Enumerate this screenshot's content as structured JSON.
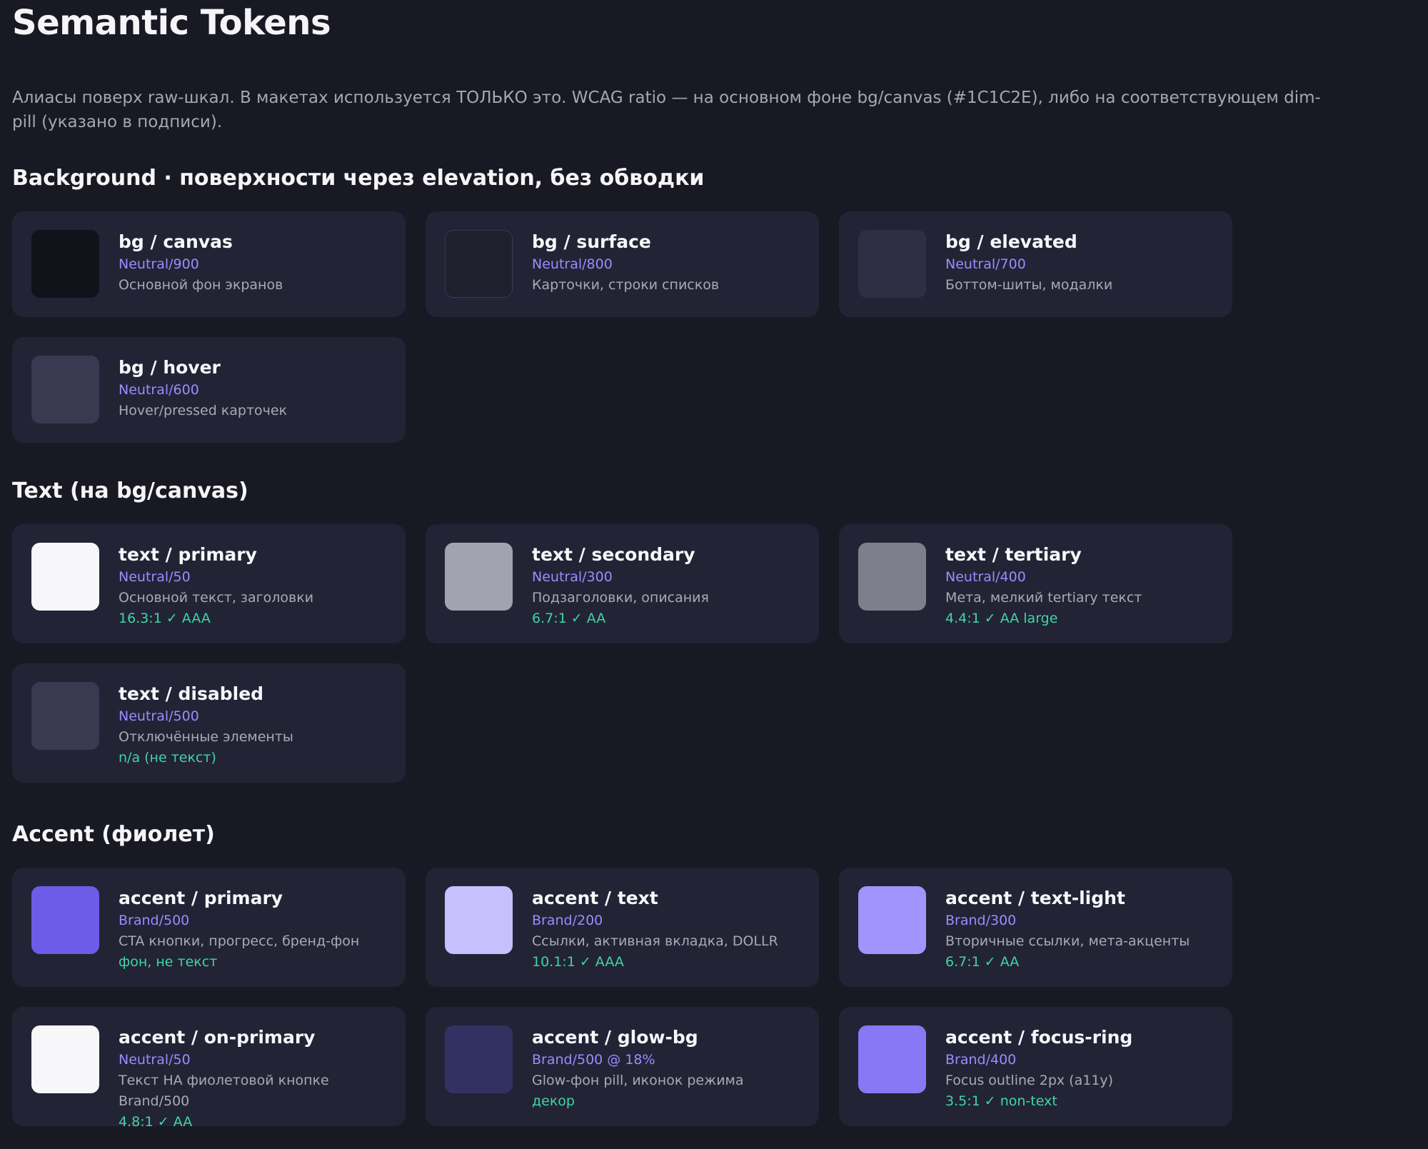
{
  "page": {
    "title": "Semantic Tokens",
    "lead": "Алиасы поверх raw-шкал. В макетах используется ТОЛЬКО это. WCAG ratio — на основном фоне bg/canvas (#1C1C2E), либо на соответствующем dim-pill (указано в подписи)."
  },
  "sections": [
    {
      "heading": "Background · поверхности через elevation, без обводки",
      "tokens": [
        {
          "name": "bg / canvas",
          "ref": "Neutral/900",
          "desc": "Основной фон экранов",
          "swatch": "#12121b"
        },
        {
          "name": "bg / surface",
          "ref": "Neutral/800",
          "desc": "Карточки, строки списков",
          "swatch": "#1f1f2e"
        },
        {
          "name": "bg / elevated",
          "ref": "Neutral/700",
          "desc": "Боттом-шиты, модалки",
          "swatch": "#2e2e45"
        },
        {
          "name": "bg / hover",
          "ref": "Neutral/600",
          "desc": "Hover/pressed карточек",
          "swatch": "#393952"
        }
      ]
    },
    {
      "heading": "Text (на bg/canvas)",
      "tokens": [
        {
          "name": "text / primary",
          "ref": "Neutral/50",
          "desc": "Основной текст, заголовки",
          "contrast": "16.3:1  ✓ AAA",
          "swatch": "#f7f7f9"
        },
        {
          "name": "text / secondary",
          "ref": "Neutral/300",
          "desc": "Подзаголовки, описания",
          "contrast": "6.7:1  ✓ AA",
          "swatch": "#a3a3b0"
        },
        {
          "name": "text / tertiary",
          "ref": "Neutral/400",
          "desc": "Мета, мелкий tertiary текст",
          "contrast": "4.4:1  ✓ AA large",
          "swatch": "#7f7f8b"
        },
        {
          "name": "text / disabled",
          "ref": "Neutral/500",
          "desc": "Отключённые элементы",
          "contrast": "n/a (не текст)",
          "swatch": "#393952"
        }
      ]
    },
    {
      "heading": "Accent (фиолет)",
      "tokens": [
        {
          "name": "accent / primary",
          "ref": "Brand/500",
          "desc": "CTA кнопки, прогресс, бренд-фон",
          "contrast": "фон, не текст",
          "swatch": "#6c5ce7"
        },
        {
          "name": "accent / text",
          "ref": "Brand/200",
          "desc": "Ссылки, активная вкладка, DOLLR",
          "contrast": "10.1:1  ✓ AAA",
          "swatch": "#c8c0fe"
        },
        {
          "name": "accent / text-light",
          "ref": "Brand/300",
          "desc": "Вторичные ссылки, мета-акценты",
          "contrast": "6.7:1  ✓ AA",
          "swatch": "#a294fd"
        },
        {
          "name": "accent / on-primary",
          "ref": "Neutral/50",
          "desc": "Текст НА фиолетовой кнопке Brand/500",
          "contrast": "4.8:1  ✓ AA",
          "swatch": "#f7f7f9"
        },
        {
          "name": "accent / glow-bg",
          "ref": "Brand/500 @ 18%",
          "desc": "Glow-фон pill, иконок режима",
          "contrast": "декор",
          "swatch": "#333162"
        },
        {
          "name": "accent / focus-ring",
          "ref": "Brand/400",
          "desc": "Focus outline 2px (a11y)",
          "contrast": "3.5:1  ✓ non-text",
          "swatch": "#8878f5"
        }
      ]
    }
  ]
}
